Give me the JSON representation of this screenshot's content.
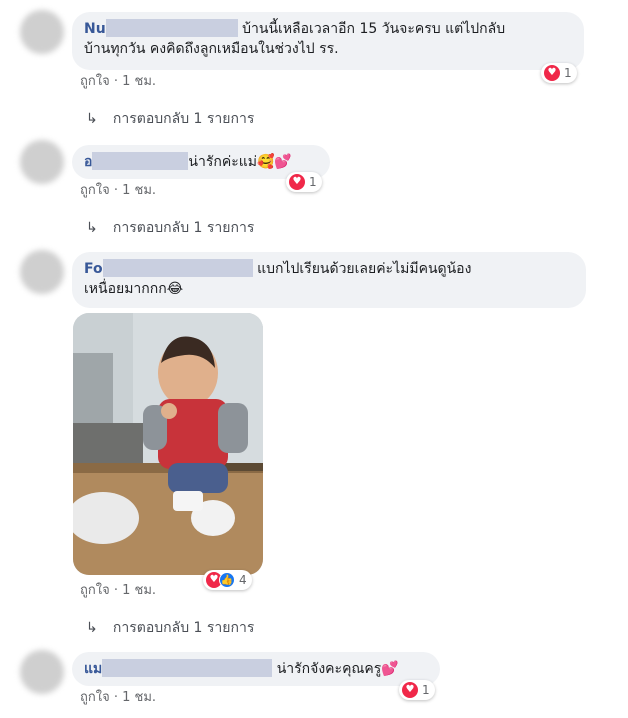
{
  "comments": [
    {
      "name_prefix": "Nu",
      "text_line1": "บ้านนี้เหลือเวลาอีก 15 วันจะครบ แต่ไปกลับ",
      "text_line2": "บ้านทุกวัน คงคิดถึงลูกเหมือนในช่วงไป รร.",
      "like_label": "ถูกใจ",
      "time": "1 ชม.",
      "reaction_count": "1",
      "reply_label": "การตอบกลับ 1 รายการ"
    },
    {
      "name_prefix": "อ",
      "text": "น่ารักค่ะแม่🥰💕",
      "like_label": "ถูกใจ",
      "time": "1 ชม.",
      "reaction_count": "1",
      "reply_label": "การตอบกลับ 1 รายการ"
    },
    {
      "name_prefix": "Fo",
      "text_line1": "แบกไปเรียนด้วยเลยค่ะไม่มีคนดูน้อง",
      "text_line2": "เหนื่อยมากกก😂",
      "like_label": "ถูกใจ",
      "time": "1 ชม.",
      "reaction_count": "4",
      "reply_label": "การตอบกลับ 1 รายการ"
    },
    {
      "name_prefix": "แม",
      "text": "น่ารักจังคะคุณครู💕",
      "like_label": "ถูกใจ",
      "time": "1 ชม.",
      "reaction_count": "1"
    }
  ],
  "icons": {
    "reply": "reply-arrow-icon",
    "heart": "heart-reaction-icon",
    "like": "like-reaction-icon"
  },
  "colors": {
    "bubble": "#f0f2f5",
    "name": "#385898",
    "heart": "#f02849",
    "like": "#1877f2"
  }
}
